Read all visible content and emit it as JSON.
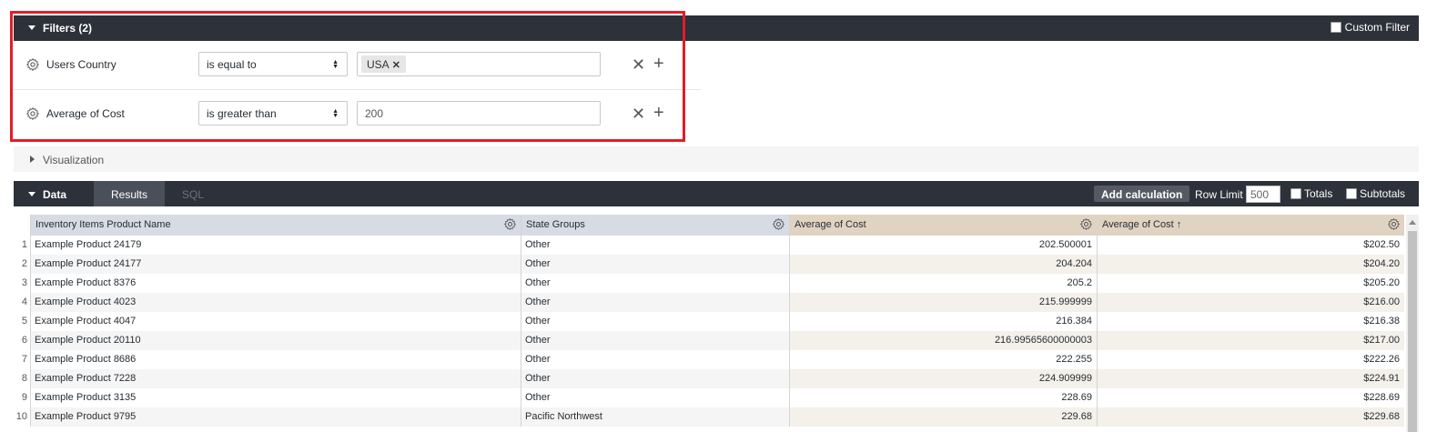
{
  "filters": {
    "title": "Filters (2)",
    "custom_filter_label": "Custom Filter",
    "rows": [
      {
        "label_prefix": "Users ",
        "label_bold": "Country",
        "operator": "is equal to",
        "chip_value": "USA"
      },
      {
        "label": "Average of Cost",
        "operator": "is greater than",
        "value": "200"
      }
    ]
  },
  "visualization": {
    "title": "Visualization"
  },
  "data": {
    "title": "Data",
    "tabs": {
      "results": "Results",
      "sql": "SQL"
    },
    "add_calculation": "Add calculation",
    "row_limit_label": "Row Limit",
    "row_limit_value": "500",
    "totals_label": "Totals",
    "subtotals_label": "Subtotals"
  },
  "table": {
    "headers": {
      "col1_prefix": "Inventory Items ",
      "col1_bold": "Product Name",
      "col2": "State Groups",
      "col3": "Average of Cost",
      "col4": "Average of Cost ↑"
    },
    "rows": [
      {
        "n": "1",
        "product": "Example Product 24179",
        "state": "Other",
        "avg": "202.500001",
        "avg_fmt": "$202.50"
      },
      {
        "n": "2",
        "product": "Example Product 24177",
        "state": "Other",
        "avg": "204.204",
        "avg_fmt": "$204.20"
      },
      {
        "n": "3",
        "product": "Example Product 8376",
        "state": "Other",
        "avg": "205.2",
        "avg_fmt": "$205.20"
      },
      {
        "n": "4",
        "product": "Example Product 4023",
        "state": "Other",
        "avg": "215.999999",
        "avg_fmt": "$216.00"
      },
      {
        "n": "5",
        "product": "Example Product 4047",
        "state": "Other",
        "avg": "216.384",
        "avg_fmt": "$216.38"
      },
      {
        "n": "6",
        "product": "Example Product 20110",
        "state": "Other",
        "avg": "216.99565600000003",
        "avg_fmt": "$217.00"
      },
      {
        "n": "7",
        "product": "Example Product 8686",
        "state": "Other",
        "avg": "222.255",
        "avg_fmt": "$222.26"
      },
      {
        "n": "8",
        "product": "Example Product 7228",
        "state": "Other",
        "avg": "224.909999",
        "avg_fmt": "$224.91"
      },
      {
        "n": "9",
        "product": "Example Product 3135",
        "state": "Other",
        "avg": "228.69",
        "avg_fmt": "$228.69"
      },
      {
        "n": "10",
        "product": "Example Product 9795",
        "state": "Pacific Northwest",
        "avg": "229.68",
        "avg_fmt": "$229.68"
      }
    ]
  },
  "colors": {
    "bar_dark": "#2d3139",
    "highlight_red": "#e21d27",
    "dimension_header": "#d6dbe4",
    "measure_header": "#e1d3c2",
    "measure_alt_row": "#f4f0ea",
    "dim_alt_row": "#f5f5f5"
  },
  "icons": {
    "gear": "gear-icon",
    "remove": "close-icon",
    "add": "plus-icon"
  }
}
